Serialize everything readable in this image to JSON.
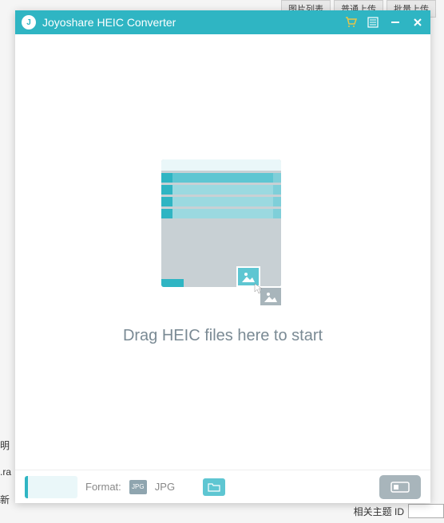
{
  "background": {
    "tabs": [
      "图片列表",
      "普通上传",
      "批量上传"
    ],
    "bottom_label": "相关主题 ID",
    "left_label": "明",
    "ra_label": ".ra",
    "xin_label": "新"
  },
  "titlebar": {
    "title": "Joyoshare HEIC Converter",
    "logo_text": "J",
    "icons": {
      "cart": "cart-icon",
      "list": "list-icon",
      "minimize": "minimize-icon",
      "close": "close-icon"
    }
  },
  "content": {
    "drop_text": "Drag HEIC files here to start"
  },
  "bottombar": {
    "format_label": "Format:",
    "format_badge": "JPG",
    "format_value": "JPG"
  }
}
